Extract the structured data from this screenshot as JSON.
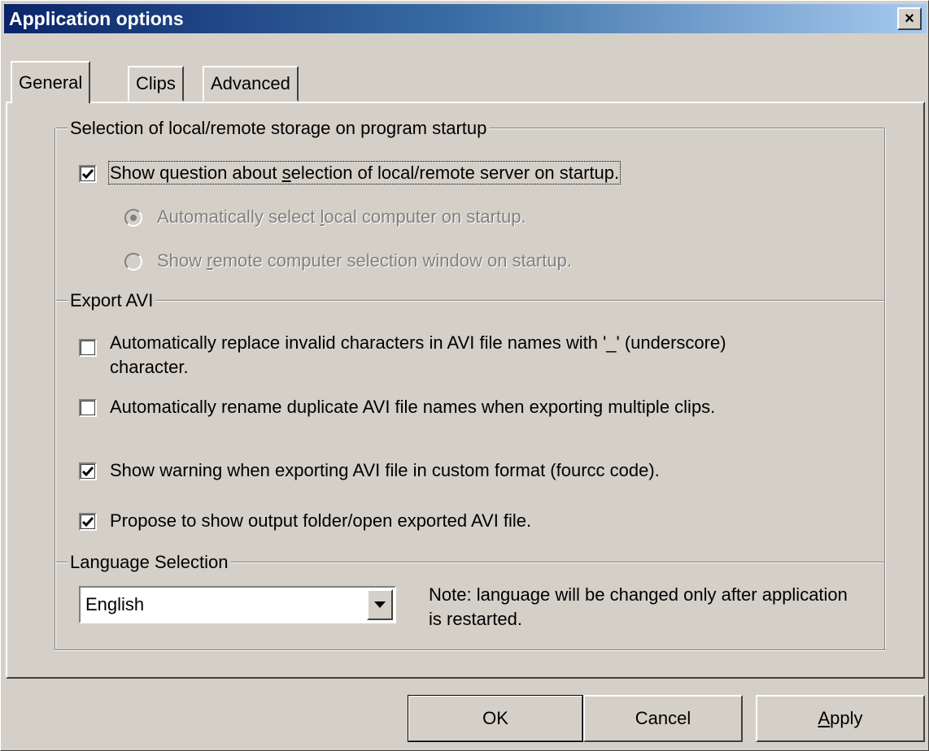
{
  "window": {
    "title": "Application options",
    "close_label": "×"
  },
  "tabs": [
    {
      "label": "General",
      "active": true
    },
    {
      "label": "Clips",
      "active": false
    },
    {
      "label": "Advanced",
      "active": false
    }
  ],
  "startup_group": {
    "title": "Selection of local/remote storage on program startup",
    "show_question": {
      "label_pre": "Show question about ",
      "label_u": "s",
      "label_post": "election of local/remote server on startup.",
      "checked": true
    },
    "radio_local": {
      "label_pre": "Automatically select ",
      "label_u": "l",
      "label_post": "ocal computer on startup.",
      "selected": true,
      "enabled": false
    },
    "radio_remote": {
      "label_pre": "Show ",
      "label_u": "r",
      "label_post": "emote computer selection window on startup.",
      "selected": false,
      "enabled": false
    }
  },
  "export_group": {
    "title": "Export AVI",
    "options": [
      {
        "label": "Automatically replace invalid characters in AVI file names with '_' (underscore) character.",
        "checked": false
      },
      {
        "label": "Automatically rename duplicate AVI file names when exporting multiple clips.",
        "checked": false
      },
      {
        "label": "Show warning when exporting AVI file in custom format (fourcc code).",
        "checked": true
      },
      {
        "label": "Propose to show output folder/open exported AVI file.",
        "checked": true
      }
    ]
  },
  "language_group": {
    "title": "Language Selection",
    "selected_language": "English",
    "note": "Note: language will be changed only after application is restarted."
  },
  "buttons": {
    "ok": "OK",
    "cancel": "Cancel",
    "apply_u": "A",
    "apply_rest": "pply"
  },
  "colors": {
    "face": "#d4d0c8",
    "title_start": "#0a246a",
    "title_end": "#a6caf0",
    "disabled_text": "#808080"
  }
}
